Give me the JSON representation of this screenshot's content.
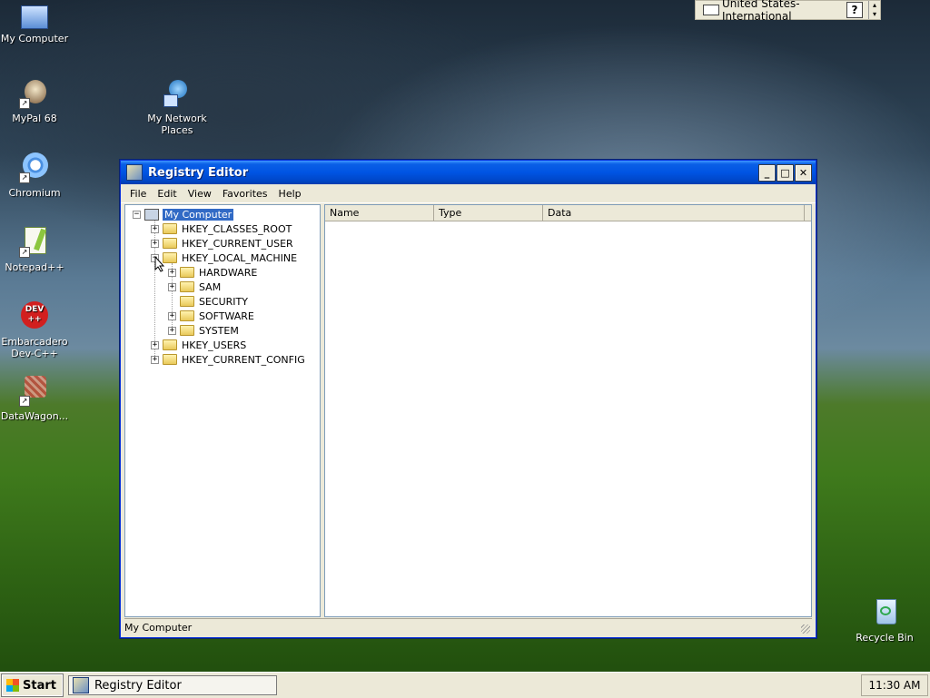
{
  "desktop": {
    "icons": [
      {
        "label": "My Computer",
        "icon": "computer-icon"
      },
      {
        "label": "MyPal 68",
        "icon": "browser-icon"
      },
      {
        "label": "My Network Places",
        "icon": "network-icon"
      },
      {
        "label": "Chromium",
        "icon": "chromium-icon"
      },
      {
        "label": "Notepad++",
        "icon": "notepad-icon"
      },
      {
        "label": "Embarcadero Dev-C++",
        "icon": "devcpp-icon"
      },
      {
        "label": "DataWagon...",
        "icon": "datawagon-icon"
      },
      {
        "label": "Recycle Bin",
        "icon": "recycle-bin-icon"
      }
    ]
  },
  "langbar": {
    "language": "United States-International",
    "help": "?"
  },
  "window": {
    "title": "Registry Editor",
    "controls": {
      "minimize": "_",
      "maximize": "□",
      "close": "✕"
    },
    "menu": [
      "File",
      "Edit",
      "View",
      "Favorites",
      "Help"
    ],
    "tree": {
      "root": "My Computer",
      "hives": [
        "HKEY_CLASSES_ROOT",
        "HKEY_CURRENT_USER",
        "HKEY_LOCAL_MACHINE",
        "HKEY_USERS",
        "HKEY_CURRENT_CONFIG"
      ],
      "hklm_children": [
        "HARDWARE",
        "SAM",
        "SECURITY",
        "SOFTWARE",
        "SYSTEM"
      ]
    },
    "list_columns": [
      "Name",
      "Type",
      "Data"
    ],
    "status": "My Computer"
  },
  "taskbar": {
    "start_label": "Start",
    "active_task": "Registry Editor",
    "clock": "11:30 AM"
  }
}
